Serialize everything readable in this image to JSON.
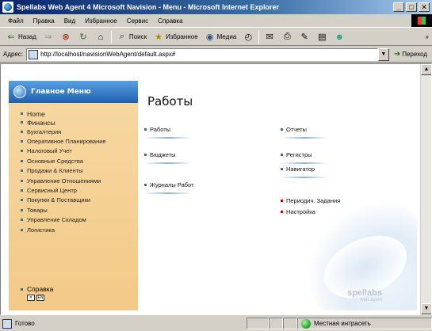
{
  "window": {
    "title": "Spellabs Web Agent 4 Microsoft Navision - Menu - Microsoft Internet Explorer",
    "buttons": [
      "_",
      "□",
      "✕"
    ]
  },
  "menubar": {
    "items": [
      "Файл",
      "Правка",
      "Вид",
      "Избранное",
      "Сервис",
      "Справка"
    ]
  },
  "toolbar": {
    "back": "Назад",
    "search": "Поиск",
    "favorites": "Избранное",
    "media": "Медиа",
    "more": "»"
  },
  "address": {
    "label": "Адрес:",
    "url": "http://localhost/navisionWebAgent/default.aspx#",
    "go": "Переход"
  },
  "sidebar": {
    "title": "Главное Меню",
    "items": [
      {
        "label": "Home",
        "big": true
      },
      {
        "label": "Финансы",
        "big": true
      },
      {
        "label": "Бухгалтерия"
      },
      {
        "label": "Оперативное Планирование"
      },
      {
        "label": "Налоговый Учет"
      },
      {
        "label": "Основные Средства"
      },
      {
        "label": "Продажи & Клиенты"
      },
      {
        "label": "Управление Отношениями"
      },
      {
        "label": "Сервисный Центр"
      },
      {
        "label": "Покупки & Поставщики"
      },
      {
        "label": "Товары"
      },
      {
        "label": "Управление Складом"
      },
      {
        "label": "Логистика"
      }
    ],
    "help": "Справка"
  },
  "main": {
    "title": "Работы",
    "links": [
      {
        "label": "Работы",
        "col": 0,
        "row": 0,
        "accent": "#3a6ea5"
      },
      {
        "label": "Отчеты",
        "col": 1,
        "row": 0,
        "accent": "#3a6ea5"
      },
      {
        "label": "Бюджеты",
        "col": 0,
        "row": 1,
        "accent": "#3a6ea5"
      },
      {
        "label": "Регистры",
        "col": 1,
        "row": 1,
        "accent": "#3a6ea5"
      },
      {
        "label": "Навигатор",
        "col": 1,
        "row": 2,
        "accent": "#3a6ea5"
      },
      {
        "label": "Журналы Работ",
        "col": 0,
        "row": 3,
        "accent": "#3a6ea5"
      },
      {
        "label": "Периодич. Задания",
        "col": 1,
        "row": 4,
        "accent": "#dd0000"
      },
      {
        "label": "Настройка",
        "col": 1,
        "row": 5,
        "accent": "#dd0000"
      }
    ],
    "brand_name": "spellabs",
    "brand_sub": "web.agent"
  },
  "status": {
    "text": "Готово",
    "zone": "Местная интрасеть"
  }
}
